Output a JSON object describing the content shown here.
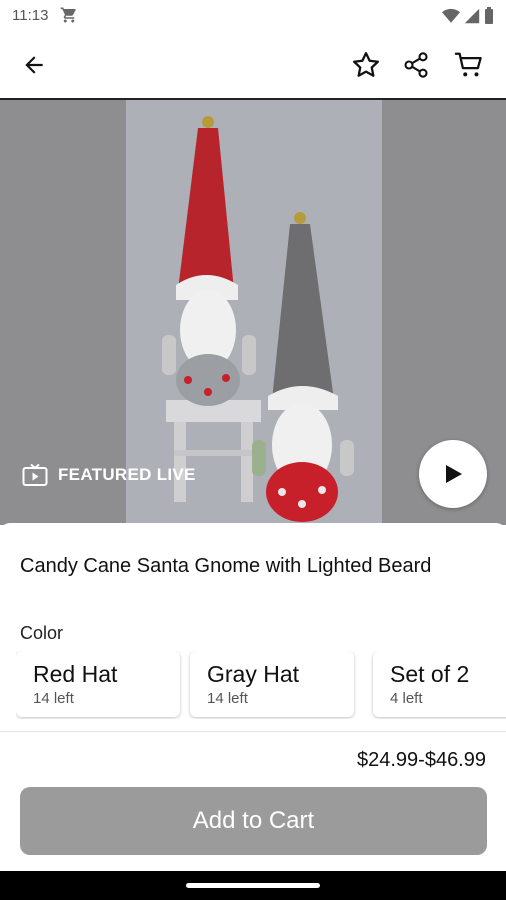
{
  "status_bar": {
    "time": "11:13"
  },
  "hero": {
    "featured_label": "FEATURED LIVE"
  },
  "product": {
    "title": "Candy Cane Santa Gnome with Lighted Beard",
    "color_label": "Color",
    "variants": [
      {
        "name": "Red Hat",
        "stock": "14 left"
      },
      {
        "name": "Gray Hat",
        "stock": "14 left"
      },
      {
        "name": "Set of 2",
        "stock": "4 left"
      }
    ],
    "price": "$24.99-$46.99"
  },
  "actions": {
    "add_to_cart": "Add to Cart"
  },
  "colors": {
    "button_gray": "#9b9b9b",
    "red_hat": "#c8202b",
    "gray_hat": "#6e6e70"
  }
}
